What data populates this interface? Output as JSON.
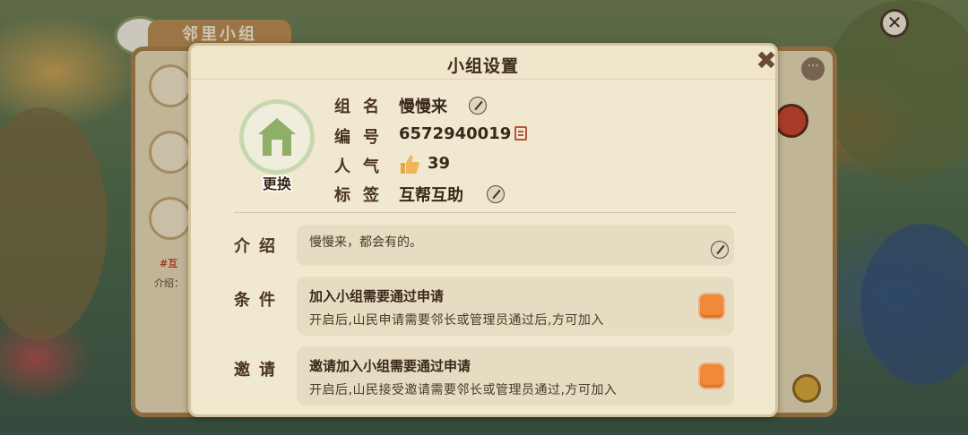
{
  "background": {
    "panel_title": "邻里小组",
    "side_labels": [
      "互",
      "介绍："
    ],
    "menu_dots": "···",
    "close_glyph": "✕"
  },
  "dialog": {
    "title": "小组设置",
    "close_glyph": "✖",
    "icon": {
      "name": "hut-icon",
      "change_label": "更换"
    },
    "info": {
      "name_label": "组名",
      "name_value": "慢慢来",
      "id_label": "编号",
      "id_value": "6572940019",
      "popularity_label": "人气",
      "popularity_value": "39",
      "tag_label": "标签",
      "tag_value": "互帮互助"
    },
    "intro": {
      "label": "介绍",
      "text": "慢慢来，都会有的。"
    },
    "condition": {
      "label": "条件",
      "title": "加入小组需要通过申请",
      "desc": "开启后,山民申请需要邻长或管理员通过后,方可加入",
      "enabled": true
    },
    "invite": {
      "label": "邀请",
      "title": "邀请加入小组需要通过申请",
      "desc": "开启后,山民接受邀请需要邻长或管理员通过,方可加入",
      "enabled": true
    }
  },
  "colors": {
    "dialog_bg": "#f1e8d0",
    "row_bg": "#e6dcc2",
    "toggle_on": "#f08a38",
    "text_dark": "#3a281a",
    "icon_green": "#8fae66"
  }
}
